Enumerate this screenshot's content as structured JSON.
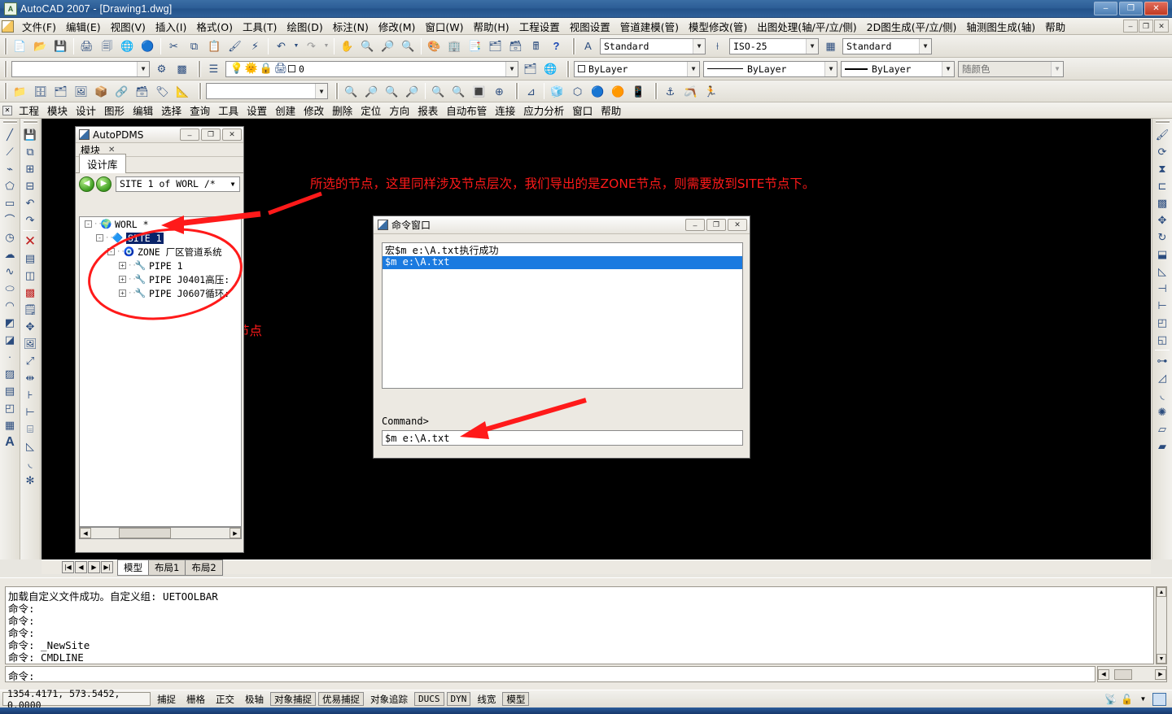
{
  "window": {
    "title": "AutoCAD 2007 - [Drawing1.dwg]",
    "app_icon": "autocad-icon",
    "minimize": "–",
    "maximize": "❐",
    "close": "✕"
  },
  "menubar": {
    "items": [
      "文件(F)",
      "编辑(E)",
      "视图(V)",
      "插入(I)",
      "格式(O)",
      "工具(T)",
      "绘图(D)",
      "标注(N)",
      "修改(M)",
      "窗口(W)",
      "帮助(H)",
      "工程设置",
      "视图设置",
      "管道建模(管)",
      "模型修改(管)",
      "出图处理(轴/平/立/侧)",
      "2D图生成(平/立/侧)",
      "轴测图生成(轴)",
      "帮助"
    ],
    "mdi_buttons": [
      "–",
      "❐",
      "✕"
    ]
  },
  "toolbar_row1": {
    "icons": [
      "new-icon",
      "open-icon",
      "save-icon",
      "plot-icon",
      "plot-preview-icon",
      "publish-icon",
      "web-publish-icon",
      "cut-icon",
      "copy-icon",
      "paste-icon",
      "match-properties-icon",
      "block-editor-icon",
      "undo-icon",
      "undo-dropdown-icon",
      "redo-icon",
      "redo-dropdown-icon",
      "pan-icon",
      "zoom-realtime-icon",
      "zoom-window-icon",
      "zoom-previous-icon",
      "properties-icon",
      "designcenter-icon",
      "tool-palettes-icon",
      "markup-icon",
      "sheet-set-icon",
      "calculator-icon",
      "help-icon"
    ],
    "text_style": {
      "label": "Standard",
      "icon": "text-style-icon"
    },
    "dim_style": {
      "label": "ISO-25",
      "icon": "dim-style-icon"
    },
    "table_style": {
      "label": "Standard",
      "icon": "table-style-icon"
    }
  },
  "toolbar_row2": {
    "layer_name": "0",
    "layer_name_placeholder": "",
    "unnamed_combo_value": "",
    "icons": [
      "layer-manager-icon",
      "layer-states-icon",
      "layer-previous-icon",
      "layer-make-current-icon",
      "light-on-icon",
      "freeze-icon",
      "lock-icon",
      "plot-layer-icon"
    ],
    "color_control": {
      "value": "ByLayer",
      "swatch": "#ffffff"
    },
    "linetype_control": {
      "value": "ByLayer"
    },
    "lineweight_control": {
      "value": "ByLayer"
    },
    "plotstyle_control": {
      "value": "随颜色",
      "disabled": true
    }
  },
  "toolbar_row3": {
    "icons": [
      "open-drawing-icon",
      "save-drawing-icon",
      "xref-icon",
      "attach-image-icon",
      "insert-block-icon",
      "external-ref-icon",
      "dbconnect-icon",
      "field-icon",
      "layout-icon",
      "named-views-icon",
      "zoom-in-icon",
      "zoom-out-icon",
      "zoom-extents-icon",
      "zoom-all-icon",
      "zoom-scale-icon",
      "zoom-center-icon",
      "ucs-icon",
      "3dview-box-icon",
      "3dview-iso-icon",
      "shade-icon",
      "render-icon",
      "render-setup-icon",
      "ucs-world-icon",
      "ucs-previous-icon",
      "ucs-apply-icon"
    ],
    "named_views_value": ""
  },
  "pdms_menubar": {
    "close_icon": "close-icon",
    "items": [
      "工程",
      "模块",
      "设计",
      "图形",
      "编辑",
      "选择",
      "查询",
      "工具",
      "设置",
      "创建",
      "修改",
      "删除",
      "定位",
      "方向",
      "报表",
      "自动布管",
      "连接",
      "应力分析",
      "窗口",
      "帮助"
    ]
  },
  "left_toolbar_1": {
    "icons": [
      "line-icon",
      "construction-line-icon",
      "polyline-icon",
      "polygon-icon",
      "rectangle-icon",
      "arc-icon",
      "circle-icon",
      "revision-cloud-icon",
      "spline-icon",
      "ellipse-icon",
      "ellipse-arc-icon",
      "insert-block-icon",
      "make-block-icon",
      "point-icon",
      "hatch-icon",
      "gradient-icon",
      "region-icon",
      "table-icon",
      "multiline-text-icon"
    ]
  },
  "left_toolbar_2": {
    "icons": [
      "save-red-icon",
      "copy-object-icon",
      "add-solid-icon",
      "subtract-solid-icon",
      "undo-arrow-icon",
      "redo-arrow-icon",
      "erase-x-icon",
      "copy-list-icon",
      "mirror-pair-icon",
      "array-grid-icon",
      "copy-paste-icon",
      "move-icon",
      "rotate-image-icon",
      "scale-icon",
      "stretch-icon",
      "trim-icon",
      "extend-icon",
      "break-icon",
      "chamfer-icon",
      "fillet-icon",
      "explode-icon"
    ]
  },
  "right_toolbar": {
    "icons": [
      "match-prop-icon",
      "copy-rotate-icon",
      "mirror-icon",
      "offset-icon",
      "array-icon",
      "move-arrows-icon",
      "rotate-circle-icon",
      "scale-box-icon",
      "stretch-shape-icon",
      "trim-line-icon",
      "extend-line-icon",
      "break-at-icon",
      "break-icon",
      "join-icon",
      "chamfer-icon",
      "fillet-icon",
      "explode-icon",
      "up-icon",
      "down-icon"
    ]
  },
  "autopdms": {
    "title": "AutoPDMS",
    "title_icon": "pdms-window-icon",
    "title_buttons": [
      "–",
      "❐",
      "✕"
    ],
    "subtab": {
      "label": "模块",
      "close": "✕"
    },
    "tabs": [
      {
        "label": "设计库",
        "active": true
      }
    ],
    "nav": {
      "back_icon": "back-arrow-icon",
      "forward_icon": "forward-arrow-icon",
      "path_value": "SITE 1 of WORL /*",
      "dropdown_icon": "chevron-down-icon"
    },
    "tree": [
      {
        "indent": 0,
        "expander": "-",
        "icon": "world-globe-icon",
        "label": "WORL *",
        "selected": false
      },
      {
        "indent": 1,
        "expander": "-",
        "icon": "site-cube-icon",
        "label": "SITE 1",
        "selected": true
      },
      {
        "indent": 2,
        "expander": "-",
        "icon": "zone-cube-icon",
        "label": "ZONE 厂区管道系统",
        "selected": false
      },
      {
        "indent": 3,
        "expander": "+",
        "icon": "pipe-icon",
        "label": "PIPE 1",
        "selected": false
      },
      {
        "indent": 3,
        "expander": "+",
        "icon": "pipe-icon",
        "label": "PIPE J0401高压:",
        "selected": false
      },
      {
        "indent": 3,
        "expander": "+",
        "icon": "pipe-icon",
        "label": "PIPE J0607循环:",
        "selected": false
      }
    ],
    "hscroll": {
      "left_icon": "◀",
      "right_icon": "▶"
    }
  },
  "command_window": {
    "title": "命令窗口",
    "title_icon": "cmd-window-icon",
    "title_buttons": [
      "–",
      "❐",
      "✕"
    ],
    "list": [
      {
        "text": "宏$m e:\\A.txt执行成功",
        "highlighted": false
      },
      {
        "text": "$m e:\\A.txt",
        "highlighted": true
      }
    ],
    "prompt_label": "Command>",
    "input_value": "$m e:\\A.txt"
  },
  "annotations": [
    {
      "id": "annot-top",
      "text": "所选的节点，这里同样涉及节点层次，我们导出的是ZONE节点，则需要放到SITE节点下。",
      "color": "#ff1a1a"
    },
    {
      "id": "annot-bottom",
      "text": "所导入的节点",
      "color": "#ff1a1a"
    }
  ],
  "layout_tabs": {
    "nav_buttons": [
      "|◀",
      "◀",
      "▶",
      "▶|"
    ],
    "tabs": [
      {
        "label": "模型",
        "active": true
      },
      {
        "label": "布局1",
        "active": false
      },
      {
        "label": "布局2",
        "active": false
      }
    ]
  },
  "command_line": {
    "history": [
      "加载自定义文件成功。自定义组: UETOOLBAR",
      "命令:",
      "命令:",
      "命令:",
      "命令: _NewSite",
      "命令: CMDLINE"
    ],
    "current": "命令:"
  },
  "statusbar": {
    "coordinates": "1354.4171, 573.5452, 0.0000",
    "toggles": [
      {
        "label": "捕捉",
        "on": false
      },
      {
        "label": "栅格",
        "on": false
      },
      {
        "label": "正交",
        "on": false
      },
      {
        "label": "极轴",
        "on": false
      },
      {
        "label": "对象捕捉",
        "on": true
      },
      {
        "label": "优易捕捉",
        "on": true
      },
      {
        "label": "对象追踪",
        "on": false
      },
      {
        "label": "DUCS",
        "on": false
      },
      {
        "label": "DYN",
        "on": false
      },
      {
        "label": "线宽",
        "on": false
      },
      {
        "label": "模型",
        "on": false
      }
    ],
    "right_icons": [
      "communication-center-icon",
      "lock-icon",
      "chevron-down-icon",
      "maximize-viewport-icon"
    ]
  }
}
